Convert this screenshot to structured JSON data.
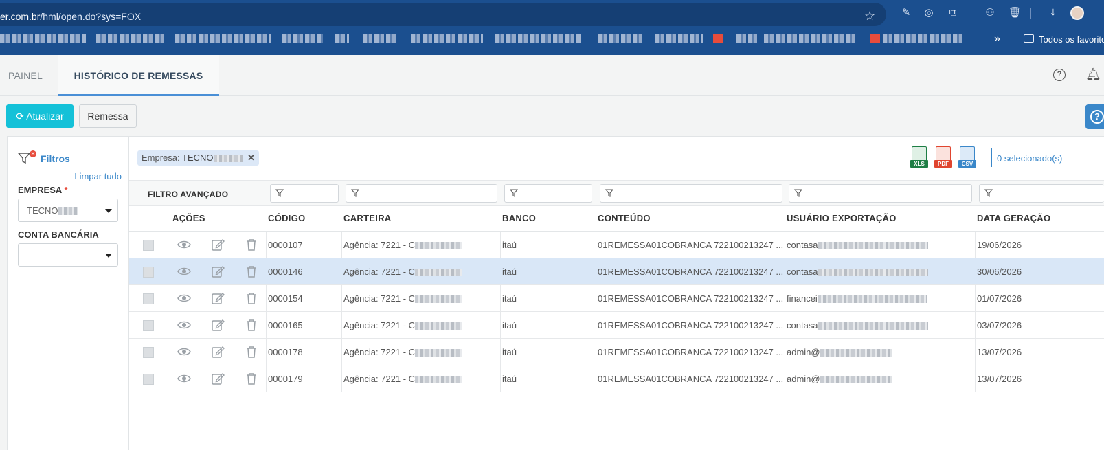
{
  "browser": {
    "url_host": "er.com.br",
    "url_path": "/hml/open.do?sys=FOX",
    "bookmarks_more": "»",
    "bookmarks_folder": "Todos os favoritos"
  },
  "tabs": [
    {
      "label": "PAINEL"
    },
    {
      "label": "HISTÓRICO DE REMESSAS"
    }
  ],
  "toolbar": {
    "refresh_label": "Atualizar",
    "remessa_label": "Remessa"
  },
  "filters": {
    "title": "Filtros",
    "clear_all": "Limpar tudo",
    "empresa_label": "EMPRESA",
    "required_mark": "*",
    "empresa_value": "TECNO",
    "conta_label": "CONTA BANCÁRIA",
    "conta_value": ""
  },
  "content": {
    "chip_key": "Empresa:",
    "chip_value": "TECNO",
    "chip_close": "✕",
    "export": [
      {
        "icon": "xls-export-icon",
        "tag": "XLS",
        "color": "#1e7e45"
      },
      {
        "icon": "pdf-export-icon",
        "tag": "PDF",
        "color": "#e0452f"
      },
      {
        "icon": "csv-export-icon",
        "tag": "CSV",
        "color": "#3a87c9"
      }
    ],
    "selected_count": "0 selecionado(s)"
  },
  "table": {
    "advanced_filter_label": "FILTRO AVANÇADO",
    "headers": {
      "acoes": "AÇÕES",
      "codigo": "CÓDIGO",
      "carteira": "CARTEIRA",
      "banco": "BANCO",
      "conteudo": "CONTEÚDO",
      "usuario": "USUÁRIO EXPORTAÇÃO",
      "data": "DATA GERAÇÃO"
    },
    "rows": [
      {
        "codigo": "0000107",
        "carteira": "Agência: 7221 - C",
        "banco": "itaú",
        "conteudo": "01REMESSA01COBRANCA 722100213247 ...",
        "usuario": "contasa",
        "data": "19/06/2026",
        "selected": false
      },
      {
        "codigo": "0000146",
        "carteira": "Agência: 7221 - C",
        "banco": "itaú",
        "conteudo": "01REMESSA01COBRANCA 722100213247 ...",
        "usuario": "contasa",
        "data": "30/06/2026",
        "selected": true
      },
      {
        "codigo": "0000154",
        "carteira": "Agência: 7221 - C",
        "banco": "itaú",
        "conteudo": "01REMESSA01COBRANCA 722100213247 ...",
        "usuario": "financei",
        "data": "01/07/2026",
        "selected": false
      },
      {
        "codigo": "0000165",
        "carteira": "Agência: 7221 - C",
        "banco": "itaú",
        "conteudo": "01REMESSA01COBRANCA 722100213247 ...",
        "usuario": "contasa",
        "data": "03/07/2026",
        "selected": false
      },
      {
        "codigo": "0000178",
        "carteira": "Agência: 7221 - C",
        "banco": "itaú",
        "conteudo": "01REMESSA01COBRANCA 722100213247 ...",
        "usuario": "admin@",
        "data": "13/07/2026",
        "selected": false
      },
      {
        "codigo": "0000179",
        "carteira": "Agência: 7221 - C",
        "banco": "itaú",
        "conteudo": "01REMESSA01COBRANCA 722100213247 ...",
        "usuario": "admin@",
        "data": "13/07/2026",
        "selected": false
      }
    ]
  }
}
